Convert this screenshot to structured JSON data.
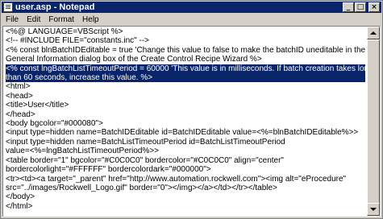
{
  "window": {
    "title": "user.asp - Notepad",
    "minimize_glyph": "_",
    "maximize_glyph": "□",
    "close_glyph": "×"
  },
  "menu": [
    "File",
    "Edit",
    "Format",
    "Help"
  ],
  "editor": {
    "lines": [
      "<%@ LANGUAGE=VBScript %>",
      "<!-- #INCLUDE FILE=\"constants.inc\" -->",
      "<% const blnBatchIDEditable = true 'Change this value to false to make the batchID uneditable in the",
      "General Information dialog box of the Create Control Recipe Wizard %>",
      "<% const lngBatchListTimeoutPeriod = 60000 'This value is in milliseconds. If batch creation takes longer",
      "than 60 seconds, increase this value. %>",
      "<html>",
      "<head>",
      "<title>User</title>",
      "</head>",
      "<body bgcolor=\"#000080\">",
      "<input type=hidden name=BatchIDEditable id=BatchIDEditable value=<%=blnBatchIDEditable%>>",
      "<input type=hidden name=BatchListTimeoutPeriod id=BatchListTimeoutPeriod",
      "value=<%=lngBatchListTimeoutPeriod%>>",
      "<table border=\"1\" bgcolor=\"#C0C0C0\" bordercolor=\"#C0C0C0\" align=\"center\"",
      "bordercolorlight=\"#FFFFFF\" bordercolordark=\"#000000\">",
      "<tr><td><a target=\"_parent\" href=\"http://www.automation.rockwell.com\"><img alt=\"eProcedure\"",
      "src=\"../images/Rockwell_Logo.gif\" border=\"0\"></img></a></td></tr></table>",
      "</body>",
      "</html>"
    ],
    "selected_lines": [
      4,
      5
    ]
  },
  "colors": {
    "titlebar": "#0a246a",
    "selection": "#0a246a",
    "chrome": "#d4d0c8"
  }
}
